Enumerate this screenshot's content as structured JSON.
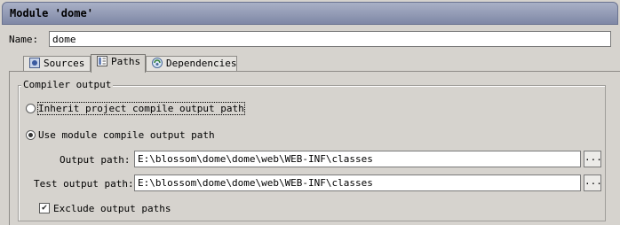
{
  "window": {
    "title": "Module 'dome'"
  },
  "name_field": {
    "label": "Name:",
    "value": "dome"
  },
  "tabs": [
    {
      "label": "Sources",
      "icon": "sources-icon",
      "active": false
    },
    {
      "label": "Paths",
      "icon": "paths-icon",
      "active": true
    },
    {
      "label": "Dependencies",
      "icon": "dependencies-icon",
      "active": false
    }
  ],
  "compiler_output": {
    "legend": "Compiler output",
    "inherit_option": {
      "label": "Inherit project compile output path",
      "selected": false
    },
    "module_option": {
      "label": "Use module compile output path",
      "selected": true
    },
    "output_path": {
      "label": "Output path:",
      "value": "E:\\blossom\\dome\\dome\\web\\WEB-INF\\classes",
      "browse": "..."
    },
    "test_output_path": {
      "label": "Test output path:",
      "value": "E:\\blossom\\dome\\dome\\web\\WEB-INF\\classes",
      "browse": "..."
    },
    "exclude_output": {
      "label": "Exclude output paths",
      "checked": true,
      "mark": "✔"
    }
  }
}
